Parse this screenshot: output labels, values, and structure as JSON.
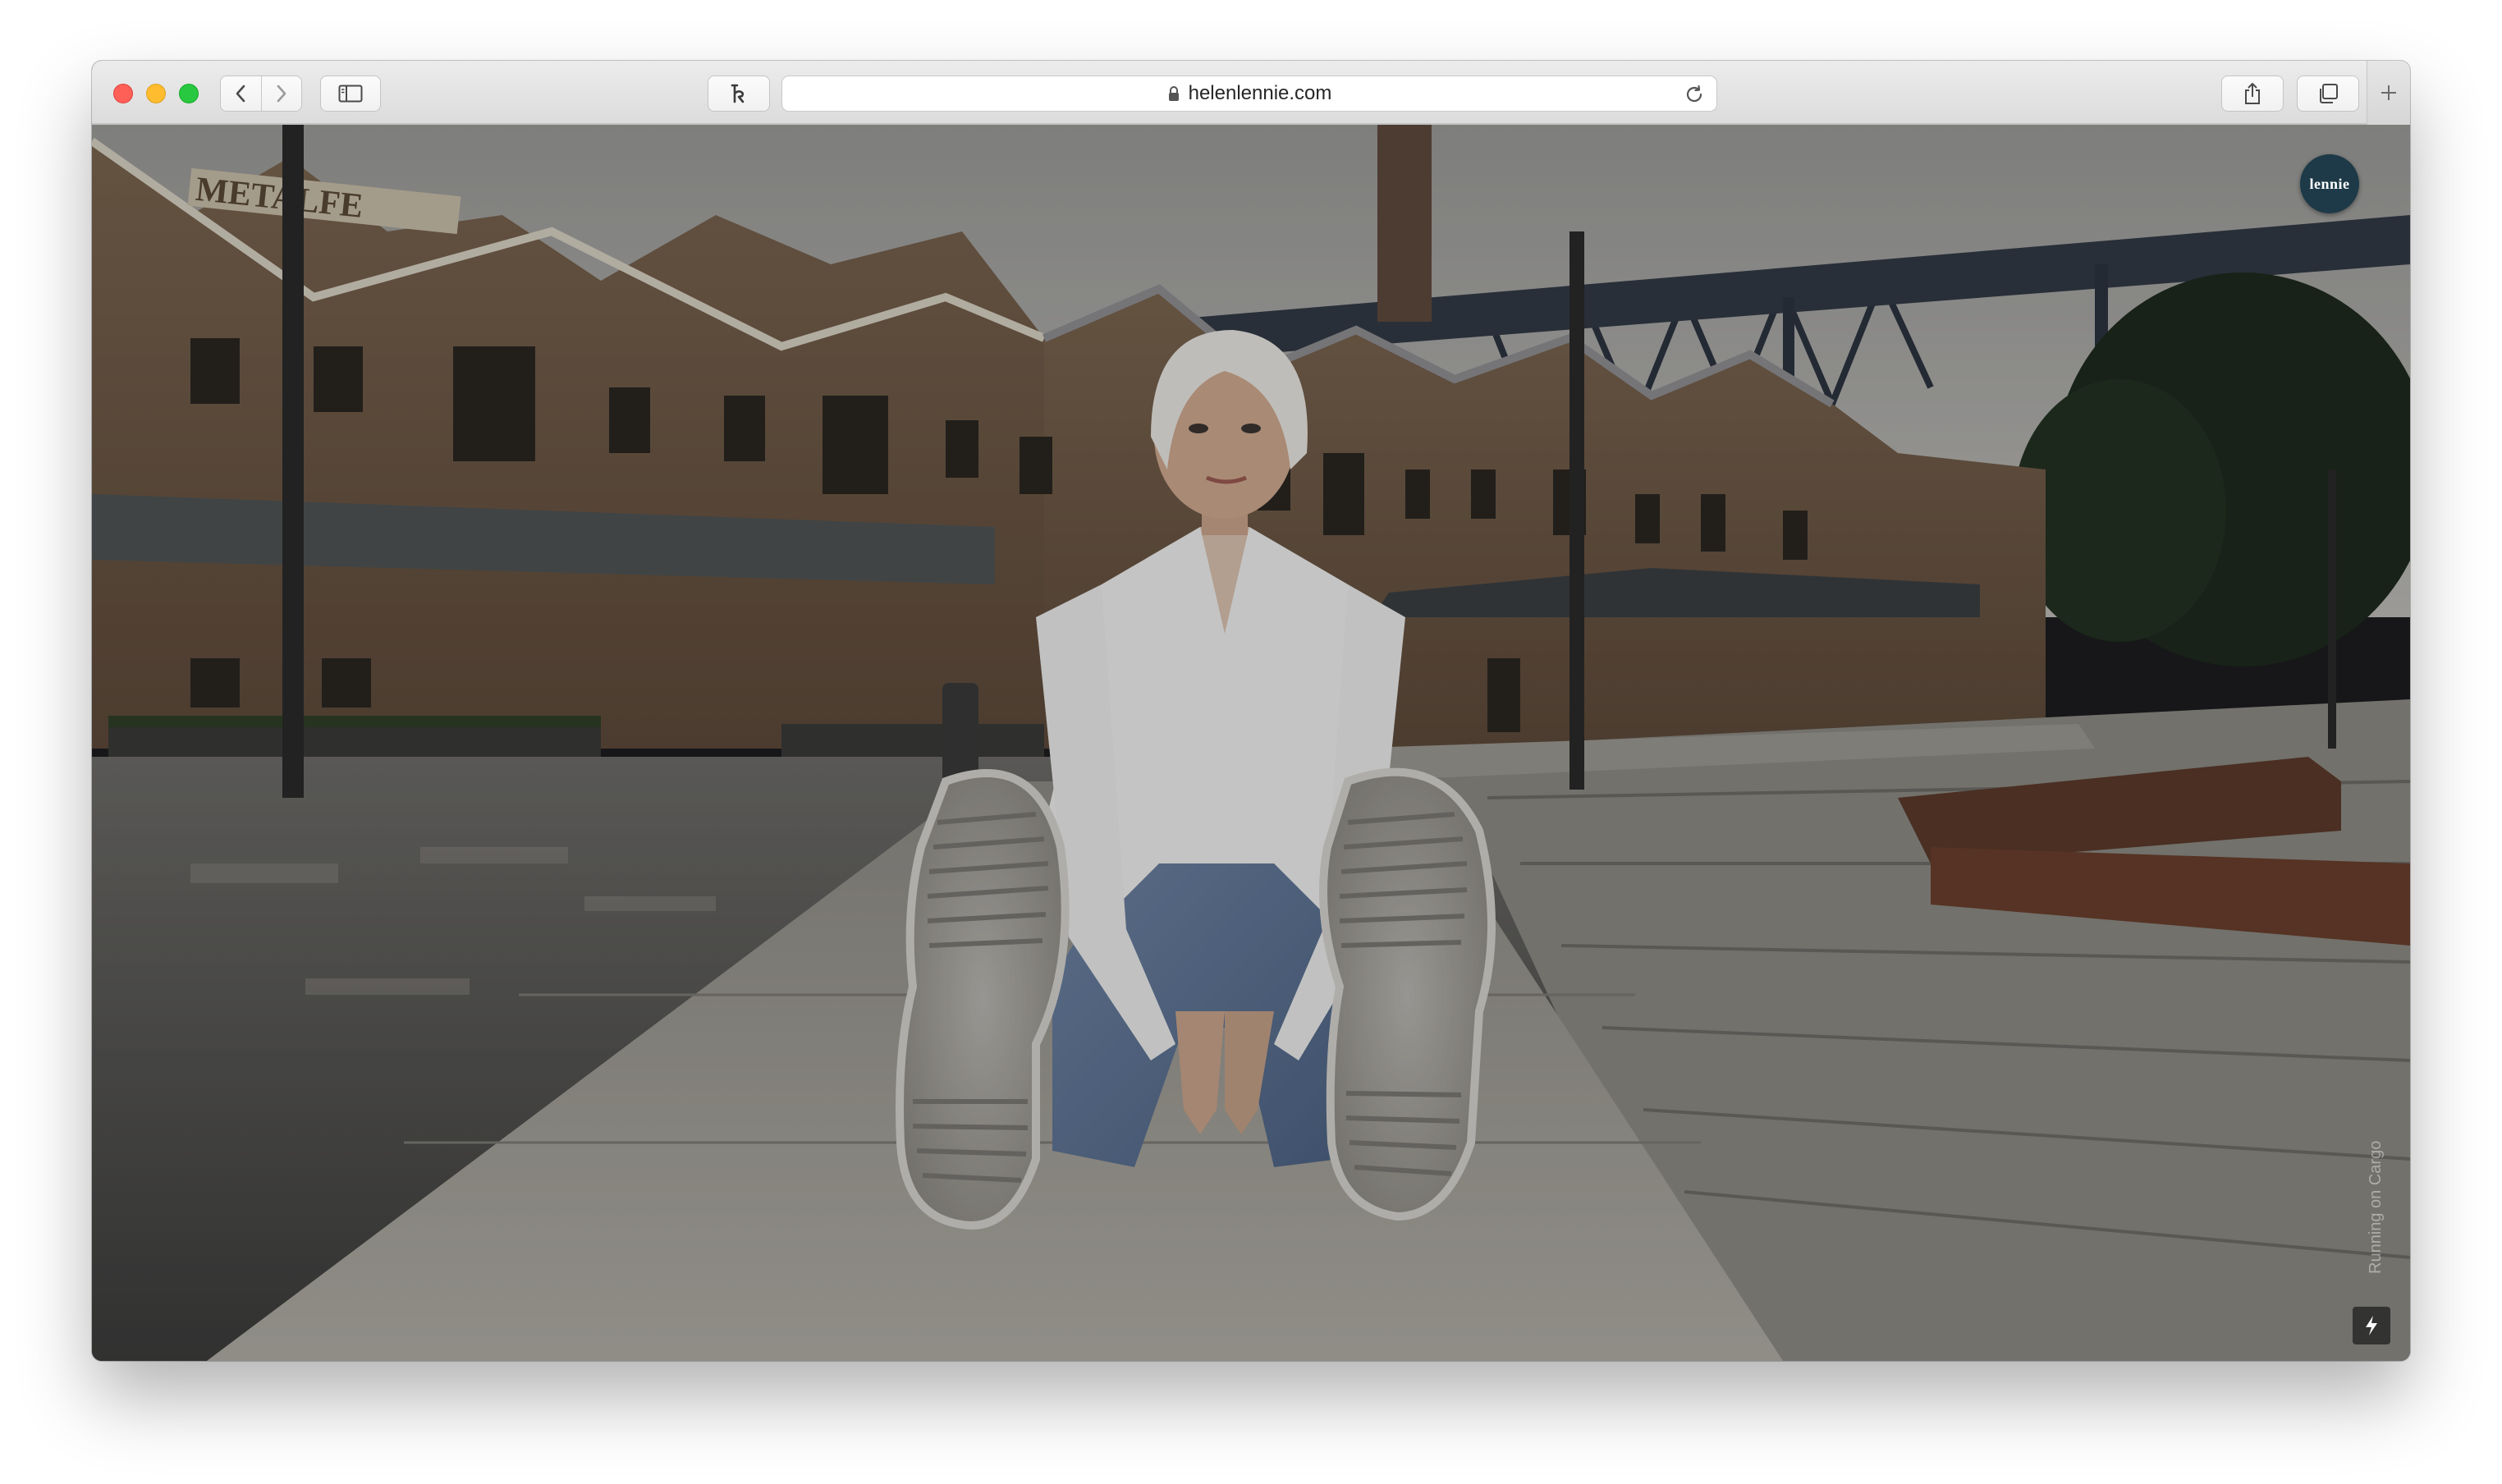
{
  "browser": {
    "url": "helenlennie.com",
    "traffic_lights": [
      "close",
      "minimize",
      "zoom"
    ],
    "toolbar_icons": [
      "back-icon",
      "forward-icon",
      "sidebar-icon",
      "extension-icon",
      "lock-icon",
      "reload-icon",
      "share-icon",
      "tabs-overview-icon",
      "plus-icon"
    ]
  },
  "page": {
    "logo_text": "lennie",
    "hero_image_subject": "woman in white shirt and jeans sitting on paving stones in a plaza in front of brick warehouses and a steel bridge",
    "running_on_text": "Running on Cargo",
    "flash_icon": "lightning-icon"
  },
  "colors": {
    "logo_badge": "#1e3a48",
    "toolbar": "#e4e4e4",
    "close": "#fe5f57",
    "minimize": "#febc2e",
    "zoom": "#28c840"
  }
}
